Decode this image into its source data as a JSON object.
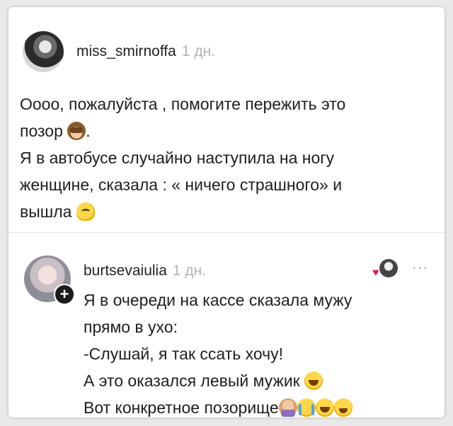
{
  "post": {
    "username": "miss_smirnoffa",
    "time": "1 дн.",
    "lines": [
      "Оооо, пожалуйста , помогите пережить это",
      "позор",
      ".",
      "Я в автобусе случайно наступила на ногу",
      "женщине, сказала : « ничего страшного» и",
      "вышла"
    ],
    "emojis": [
      "see-no-evil-monkey",
      "melting-face"
    ]
  },
  "comment": {
    "username": "burtsevaiulia",
    "time": "1 дн.",
    "follow_symbol": "+",
    "more_symbol": "···",
    "heart_symbol": "♥",
    "lines": [
      "Я в очереди на кассе сказала мужу",
      "прямо в ухо:",
      "-Слушай, я так ссать хочу!",
      "А это оказался левый мужик",
      "Вот конкретное позорище"
    ],
    "emojis": [
      "tears-of-joy",
      "facepalm",
      "crying",
      "tears-of-joy",
      "grinning-squint"
    ]
  },
  "colors": {
    "background": "#e9e9e9",
    "card": "#ffffff",
    "muted_text": "#b3b3b3",
    "heart": "#e0245e"
  }
}
